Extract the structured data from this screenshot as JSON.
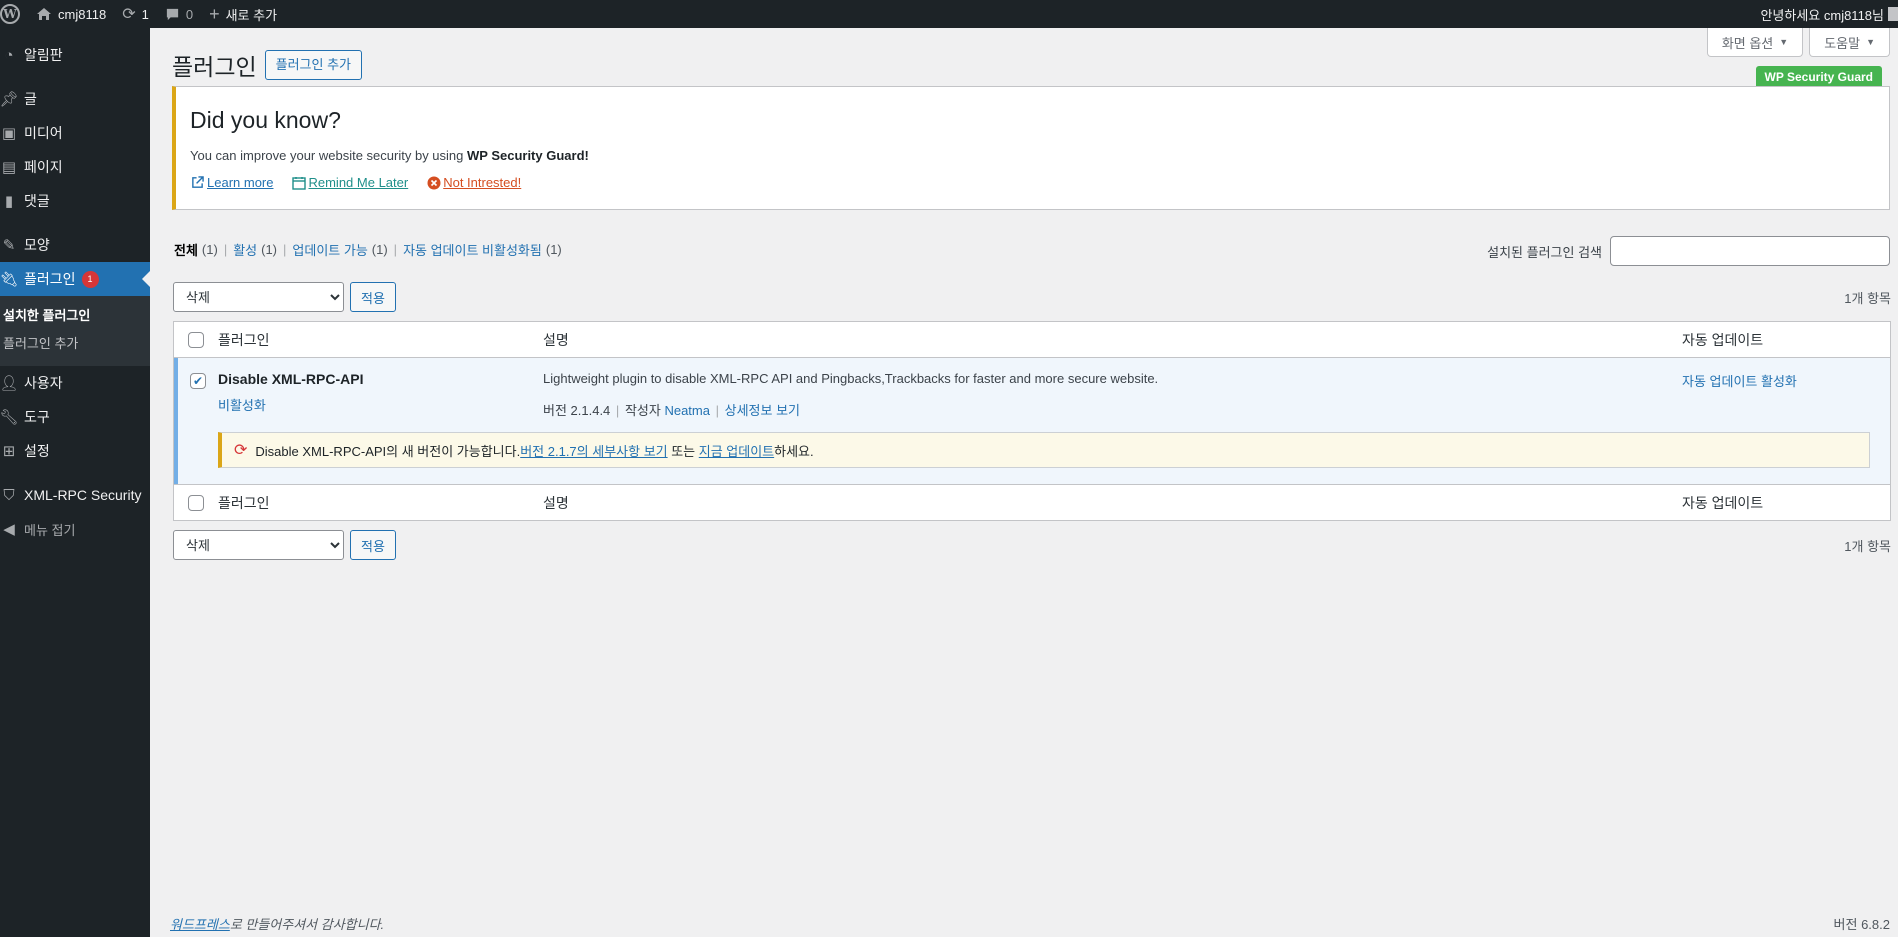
{
  "adminbar": {
    "site_name": "cmj8118",
    "updates_count": "1",
    "comments_count": "0",
    "new_label": "새로 추가",
    "greeting": "안녕하세요 cmj8118님"
  },
  "sidebar": {
    "items": [
      {
        "label": "알림판",
        "icon": "dashboard-icon"
      },
      {
        "label": "글",
        "icon": "pin-icon"
      },
      {
        "label": "미디어",
        "icon": "media-icon"
      },
      {
        "label": "페이지",
        "icon": "page-icon"
      },
      {
        "label": "댓글",
        "icon": "comment-icon"
      },
      {
        "label": "모양",
        "icon": "brush-icon"
      },
      {
        "label": "플러그인",
        "icon": "plugin-icon",
        "badge": "1"
      },
      {
        "label": "사용자",
        "icon": "user-icon"
      },
      {
        "label": "도구",
        "icon": "wrench-icon"
      },
      {
        "label": "설정",
        "icon": "settings-icon"
      },
      {
        "label": "XML-RPC Security",
        "icon": "shield-icon"
      }
    ],
    "submenu": [
      "설치한 플러그인",
      "플러그인 추가"
    ],
    "collapse_label": "메뉴 접기"
  },
  "screen_meta": {
    "screen_options": "화면 옵션",
    "help": "도움말"
  },
  "page": {
    "title": "플러그인",
    "add_button": "플러그인 추가",
    "security_tag": "WP Security Guard"
  },
  "notice": {
    "heading": "Did you know?",
    "text_prefix": "You can improve your website security by using ",
    "text_bold": "WP Security Guard!",
    "learn_more": "Learn more",
    "remind_later": "Remind Me Later",
    "not_interested": "Not Intrested!"
  },
  "filters": {
    "all": "전체",
    "all_count": "(1)",
    "active": "활성",
    "active_count": "(1)",
    "update": "업데이트 가능",
    "update_count": "(1)",
    "auto_off": "자동 업데이트 비활성화됨",
    "auto_off_count": "(1)"
  },
  "search": {
    "label": "설치된 플러그인 검색",
    "placeholder": ""
  },
  "bulk": {
    "selected": "삭제",
    "apply": "적용",
    "item_count": "1개 항목"
  },
  "table": {
    "headers": {
      "name": "플러그인",
      "description": "설명",
      "auto_update": "자동 업데이트"
    },
    "plugin": {
      "name": "Disable XML-RPC-API",
      "deactivate": "비활성화",
      "description": "Lightweight plugin to disable XML-RPC API and Pingbacks,Trackbacks for faster and more secure website.",
      "version": "버전 2.1.4.4",
      "author_label": "작성자",
      "author": "Neatma",
      "details": "상세정보 보기",
      "auto_update_link": "자동 업데이트 활성화",
      "checked": true
    },
    "update_notice": {
      "prefix": "Disable XML-RPC-API의 새 버전이 가능합니다. ",
      "details_link": "버전 2.1.7의 세부사항 보기",
      "middle": " 또는 ",
      "update_link": "지금 업데이트",
      "suffix": "하세요."
    }
  },
  "footer": {
    "wp_link": "워드프레스",
    "thanks_suffix": "로 만들어주셔서 감사합니다.",
    "version": "버전 6.8.2"
  }
}
